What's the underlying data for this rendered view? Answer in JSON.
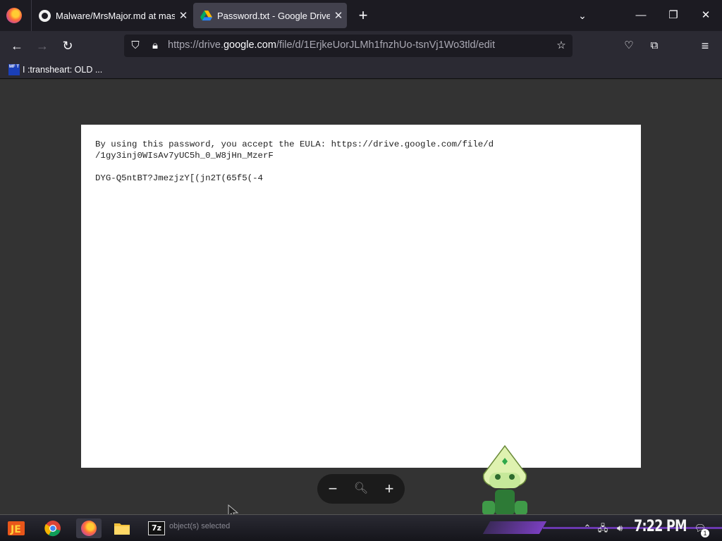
{
  "browser": {
    "tabs": [
      {
        "title": "Malware/MrsMajor.md at mas",
        "icon": "github-icon",
        "active": false
      },
      {
        "title": "Password.txt - Google Drive",
        "icon": "google-drive-icon",
        "active": true
      }
    ],
    "new_tab": "+",
    "url": {
      "prefix": "https://drive.",
      "domain": "google.com",
      "path": "/file/d/1ErjkeUorJLMh1fnzhUo-tsnVj1Wo3tld/edit"
    },
    "bookmarks": [
      {
        "label": "I :transheart: OLD ...",
        "icon_text": "MF T"
      }
    ]
  },
  "document": {
    "lines": [
      "By using this password, you accept the EULA: https://drive.google.com/file/d",
      "/1gy3inj0WIsAv7yUC5h_0_W8jHn_MzerF",
      "",
      "DYG-Q5ntBT?JmezjzY[(jn2T(65f5(-4"
    ]
  },
  "zoom_controls": {
    "zoom_out": "−",
    "zoom_in": "+"
  },
  "taskbar": {
    "status_text": "object(s) selected",
    "seven_zip_label": "7z",
    "clock": "7:22 PM",
    "notification_count": "1"
  },
  "colors": {
    "tab_bg": "#1c1b22",
    "active_tab": "#42414d",
    "content_bg": "#333333",
    "accent_purple": "#7a3fc0"
  }
}
